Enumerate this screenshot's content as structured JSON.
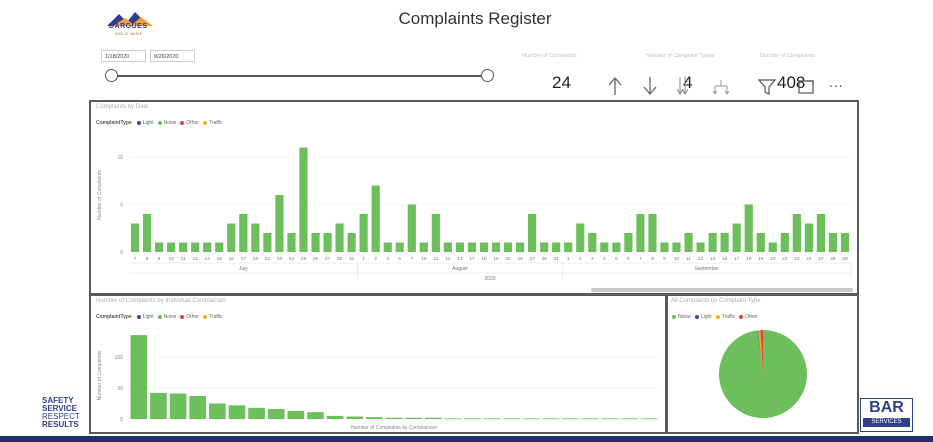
{
  "header": {
    "title": "Complaints Register",
    "logo": {
      "line1": "DARGUES",
      "line2": "GOLD MINE"
    }
  },
  "filters": {
    "start_date": "1/18/2020",
    "end_date": "9/26/2020"
  },
  "kpis": [
    {
      "label": "Number of Complaints",
      "value": "24"
    },
    {
      "label": "Number of Complaint Types",
      "value": "4"
    },
    {
      "label": "Number of Complaints",
      "value": "408"
    }
  ],
  "toolbar": {
    "icons": [
      "arrow-up-icon",
      "arrow-down-icon",
      "drill-down-icon",
      "hierarchy-icon",
      "filter-icon",
      "focus-icon",
      "more-icon"
    ],
    "more_label": "..."
  },
  "footer": {
    "left_lines": [
      "SAFETY",
      "SERVICE",
      "RESPECT",
      "RESULTS"
    ],
    "right_logo": "BAR",
    "right_sub": "SERVICES"
  },
  "legend_order_a": [
    "Light",
    "Noise",
    "Other",
    "Traffic"
  ],
  "legend_order_b": [
    "Noise",
    "Light",
    "Traffic",
    "Other"
  ],
  "legend_title": "ComplaintType",
  "colors": {
    "Light": "#3b4ba0",
    "Noise": "#6cbf5a",
    "Other": "#e0453a",
    "Traffic": "#f2b21b"
  },
  "panels": {
    "by_date": {
      "title": "Complaints by Date"
    },
    "by_complainant": {
      "title": "Number of Complaints by Individual Complainant"
    },
    "by_type": {
      "title": "All Complaints by Complaint Type"
    }
  },
  "chart_data": [
    {
      "type": "bar",
      "title": "Complaints by Date",
      "ylabel": "Number of Complaints",
      "xlabel": "",
      "ylim": [
        0,
        12
      ],
      "yticks": [
        0,
        5,
        10
      ],
      "months": [
        "July",
        "August",
        "September"
      ],
      "year": "2020",
      "categories": [
        "7",
        "8",
        "9",
        "10",
        "11",
        "12",
        "14",
        "15",
        "16",
        "17",
        "18",
        "22",
        "23",
        "24",
        "25",
        "26",
        "27",
        "30",
        "31",
        "1",
        "2",
        "3",
        "6",
        "7",
        "10",
        "11",
        "12",
        "13",
        "17",
        "18",
        "19",
        "20",
        "26",
        "27",
        "28",
        "31",
        "1",
        "2",
        "3",
        "4",
        "5",
        "6",
        "7",
        "8",
        "9",
        "10",
        "11",
        "12",
        "13",
        "16",
        "17",
        "18",
        "19",
        "20",
        "22",
        "23",
        "24",
        "27",
        "28",
        "29"
      ],
      "series": [
        {
          "name": "Noise",
          "values": [
            3,
            4,
            1,
            1,
            1,
            1,
            1,
            1,
            3,
            4,
            3,
            2,
            6,
            2,
            11,
            2,
            2,
            3,
            2,
            4,
            7,
            1,
            1,
            5,
            1,
            4,
            1,
            1,
            1,
            1,
            1,
            1,
            1,
            4,
            1,
            1,
            1,
            3,
            2,
            1,
            1,
            2,
            4,
            4,
            1,
            1,
            2,
            1,
            2,
            2,
            3,
            5,
            2,
            1,
            2,
            4,
            3,
            4,
            2,
            2
          ]
        }
      ]
    },
    {
      "type": "bar",
      "title": "Number of Complaints by Individual Complainant",
      "ylabel": "Number of Complaints",
      "xlabel": "Number of Complaints by Complainant",
      "ylim": [
        0,
        140
      ],
      "yticks": [
        0,
        50,
        100
      ],
      "series": [
        {
          "name": "Noise",
          "values": [
            135,
            42,
            41,
            37,
            25,
            22,
            18,
            16,
            13,
            11,
            5,
            4,
            3,
            2,
            2,
            2,
            1,
            1,
            1,
            1,
            1,
            1,
            1,
            1,
            1,
            1,
            1
          ]
        }
      ]
    },
    {
      "type": "pie",
      "title": "All Complaints by Complaint Type",
      "slices": [
        {
          "name": "Noise",
          "value": 400
        },
        {
          "name": "Light",
          "value": 1
        },
        {
          "name": "Traffic",
          "value": 3
        },
        {
          "name": "Other",
          "value": 4
        }
      ]
    }
  ]
}
